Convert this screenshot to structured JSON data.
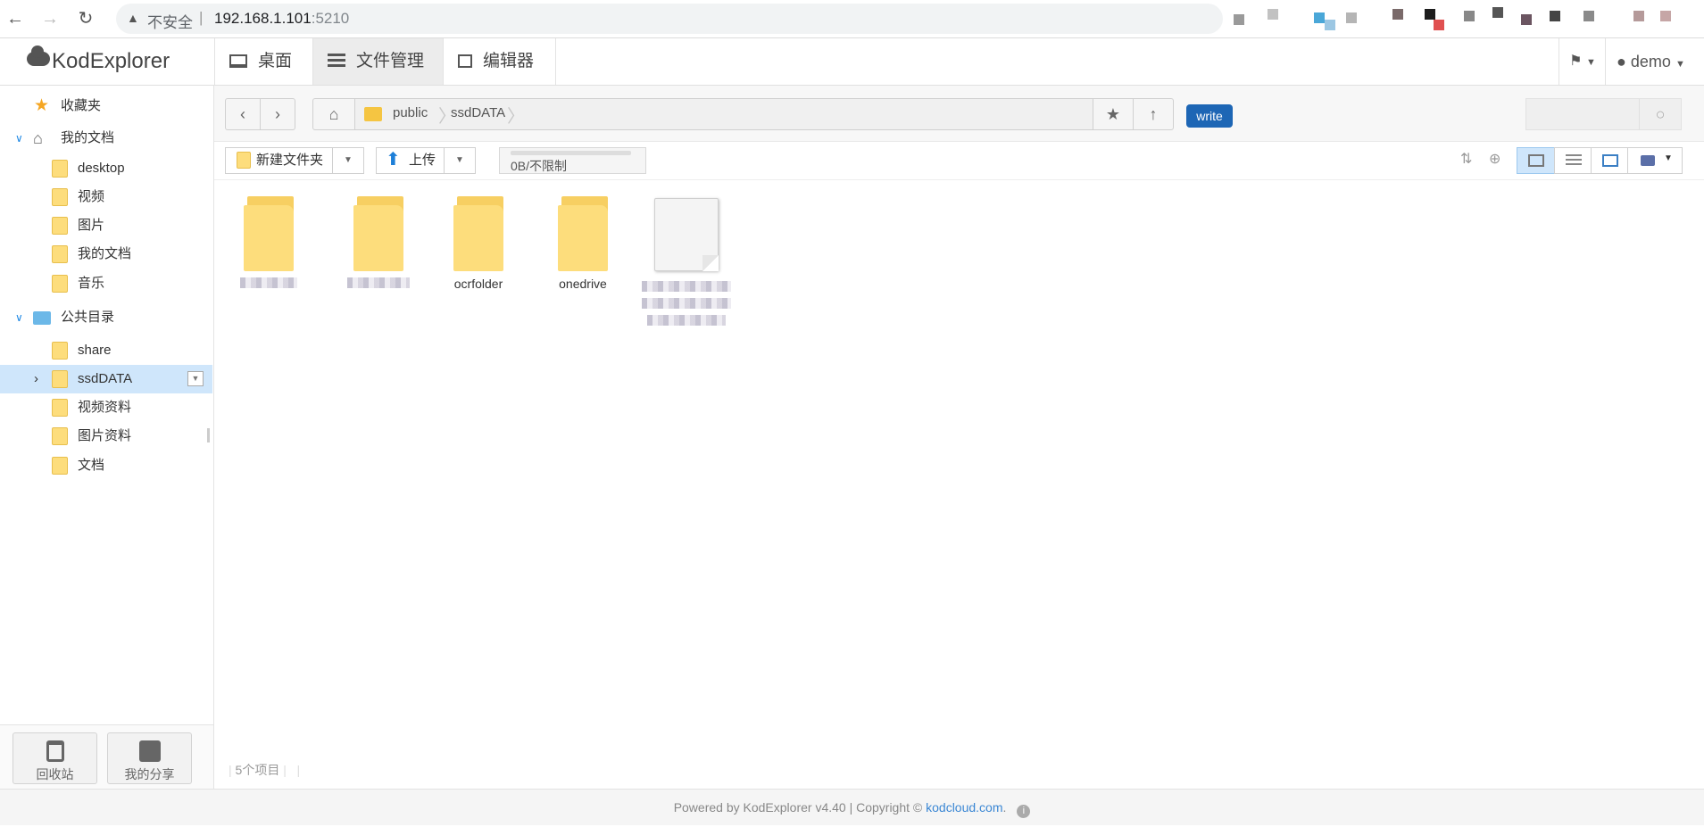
{
  "browser": {
    "insecure_label": "不安全",
    "host": "192.168.1.101",
    "port": ":5210"
  },
  "app": {
    "logo": "KodExplorer",
    "tabs": [
      {
        "label": "桌面",
        "icon": "monitor-icon"
      },
      {
        "label": "文件管理",
        "icon": "list-icon"
      },
      {
        "label": "编辑器",
        "icon": "edit-icon"
      }
    ],
    "user": "demo"
  },
  "sidebar": {
    "favorites": "收藏夹",
    "my_docs": "我的文档",
    "my_docs_children": [
      "desktop",
      "视频",
      "图片",
      "我的文档",
      "音乐"
    ],
    "public": "公共目录",
    "public_children": [
      "share",
      "ssdDATA",
      "视频资料",
      "图片资料",
      "文档"
    ],
    "selected": "ssdDATA",
    "recycle": "回收站",
    "share": "我的分享"
  },
  "pathbar": {
    "crumbs": [
      "public",
      "ssdDATA"
    ],
    "write_badge": "write"
  },
  "toolbar": {
    "new_folder": "新建文件夹",
    "upload": "上传",
    "quota": "0B/不限制"
  },
  "files": [
    {
      "name": "",
      "type": "folder",
      "blurred": true
    },
    {
      "name": "",
      "type": "folder",
      "blurred": true
    },
    {
      "name": "ocrfolder",
      "type": "folder",
      "blurred": false
    },
    {
      "name": "onedrive",
      "type": "folder",
      "blurred": false
    },
    {
      "name": "",
      "type": "file",
      "blurred": true
    }
  ],
  "status": {
    "count": "5个项目"
  },
  "footer": {
    "prefix": "Powered by KodExplorer v4.40 | Copyright © ",
    "link": "kodcloud.com",
    "suffix": "."
  }
}
